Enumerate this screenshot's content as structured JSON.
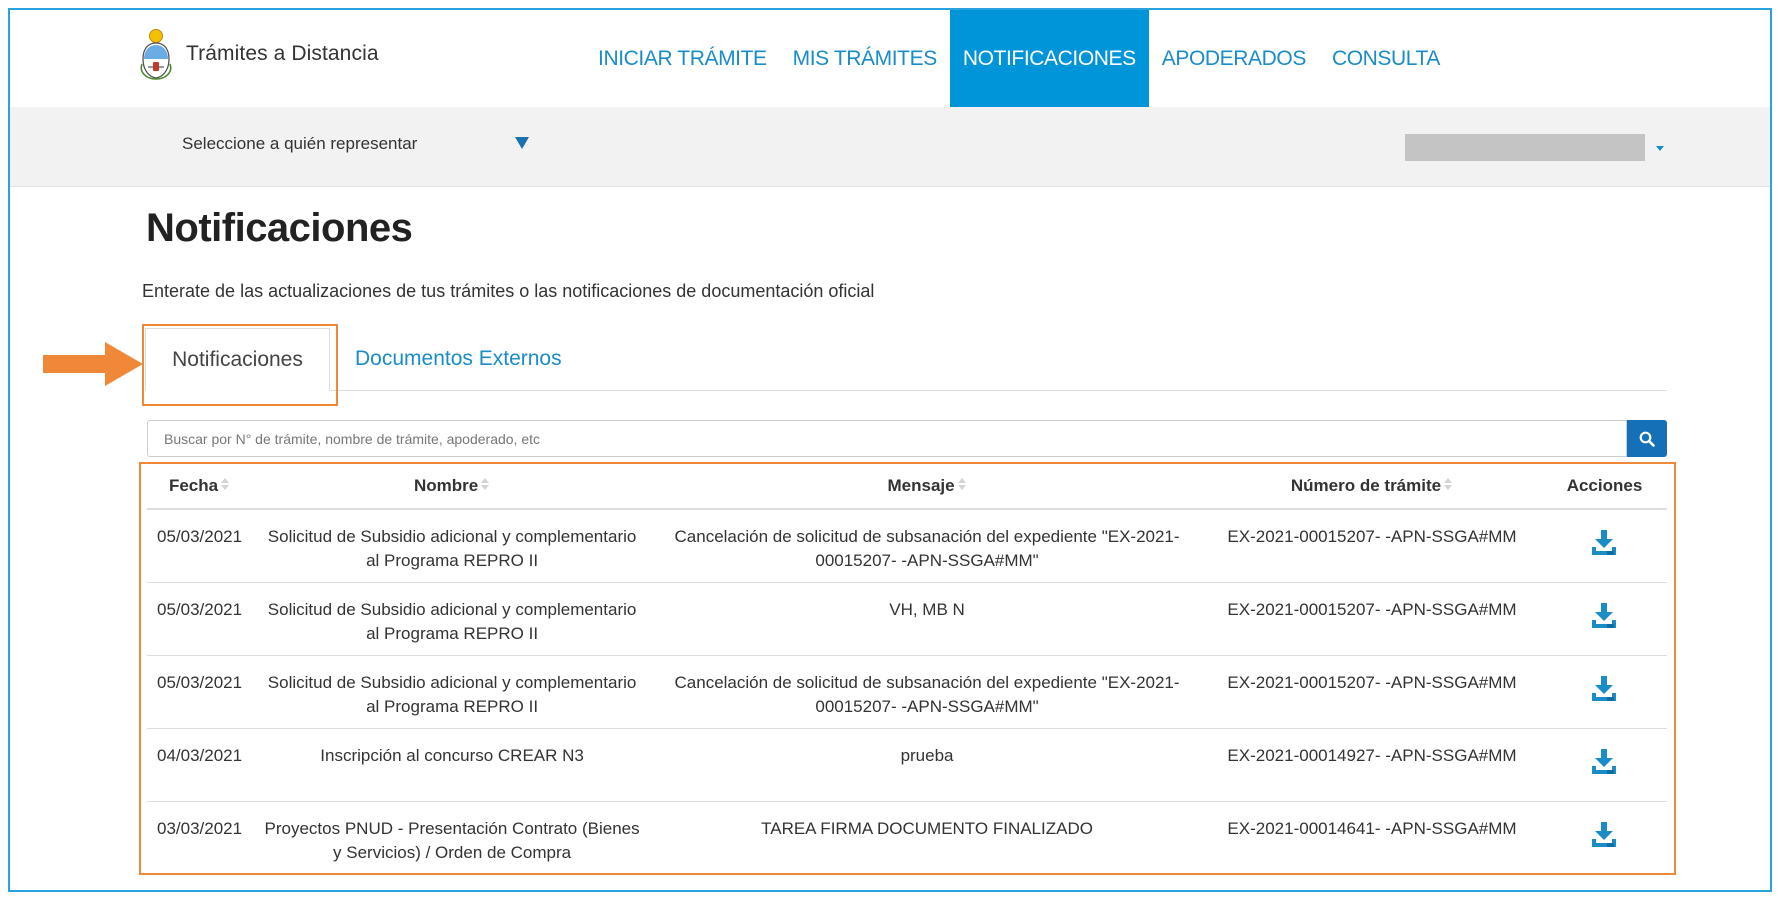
{
  "header": {
    "brand_name": "Trámites a Distancia",
    "nav": [
      {
        "label": "INICIAR TRÁMITE",
        "active": false
      },
      {
        "label": "MIS TRÁMITES",
        "active": false
      },
      {
        "label": "NOTIFICACIONES",
        "active": true
      },
      {
        "label": "APODERADOS",
        "active": false
      },
      {
        "label": "CONSULTA",
        "active": false
      }
    ]
  },
  "represent": {
    "label": "Seleccione a quién representar"
  },
  "page": {
    "title": "Notificaciones",
    "subtitle": "Enterate de las actualizaciones de tus trámites o las notificaciones de documentación oficial"
  },
  "tabs": [
    {
      "label": "Notificaciones",
      "active": true
    },
    {
      "label": "Documentos Externos",
      "active": false
    }
  ],
  "search": {
    "placeholder": "Buscar por N° de trámite, nombre de trámite, apoderado, etc"
  },
  "table": {
    "columns": [
      "Fecha",
      "Nombre",
      "Mensaje",
      "Número de trámite",
      "Acciones"
    ],
    "rows": [
      {
        "fecha": "05/03/2021",
        "nombre": "Solicitud de Subsidio adicional y complementario al Programa REPRO II",
        "mensaje": "Cancelación de solicitud de subsanación del expediente \"EX-2021-00015207- -APN-SSGA#MM\"",
        "numero": "EX-2021-00015207- -APN-SSGA#MM"
      },
      {
        "fecha": "05/03/2021",
        "nombre": "Solicitud de Subsidio adicional y complementario al Programa REPRO II",
        "mensaje": "VH, MB N",
        "numero": "EX-2021-00015207- -APN-SSGA#MM"
      },
      {
        "fecha": "05/03/2021",
        "nombre": "Solicitud de Subsidio adicional y complementario al Programa REPRO II",
        "mensaje": "Cancelación de solicitud de subsanación del expediente \"EX-2021-00015207- -APN-SSGA#MM\"",
        "numero": "EX-2021-00015207- -APN-SSGA#MM"
      },
      {
        "fecha": "04/03/2021",
        "nombre": "Inscripción al concurso CREAR N3",
        "mensaje": "prueba",
        "numero": "EX-2021-00014927- -APN-SSGA#MM"
      },
      {
        "fecha": "03/03/2021",
        "nombre": "Proyectos PNUD - Presentación Contrato (Bienes y Servicios) / Orden de Compra",
        "mensaje": "TAREA FIRMA DOCUMENTO FINALIZADO",
        "numero": "EX-2021-00014641- -APN-SSGA#MM"
      }
    ]
  },
  "colors": {
    "accent": "#0095d9",
    "link": "#1a8cc7",
    "highlight": "#f0883a",
    "search_button": "#1570b8"
  },
  "icons": {
    "brand": "argentina-seal-icon",
    "search": "magnifier-icon",
    "action": "download-icon",
    "pointer": "orange-arrow-icon"
  }
}
